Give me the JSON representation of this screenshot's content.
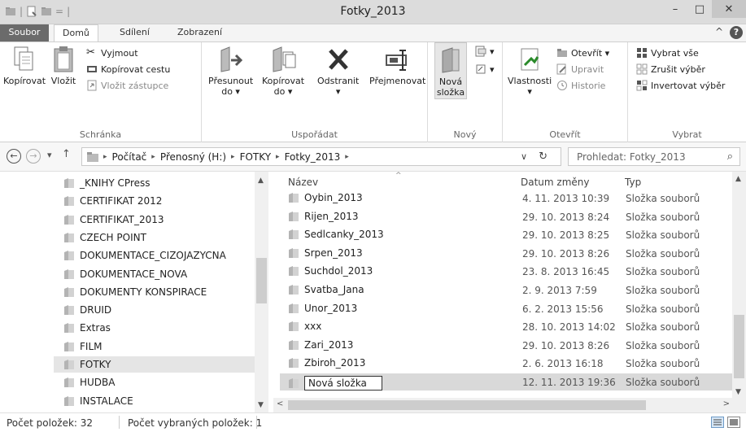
{
  "window": {
    "title": "Fotky_2013"
  },
  "window_controls": {
    "minimize": "–",
    "maximize": "□",
    "close": "✕"
  },
  "quick_access": {
    "separator": "|",
    "dropdown": "="
  },
  "ribbon_tabs": [
    "Soubor",
    "Domů",
    "Sdílení",
    "Zobrazení"
  ],
  "ribbon_ctrls": {
    "collapse": "^",
    "help": "?"
  },
  "ribbon": {
    "clipboard": {
      "label": "Schránka",
      "copy": "Kopírovat",
      "paste": "Vložit",
      "cut": "Vyjmout",
      "copy_path": "Kopírovat cestu",
      "paste_shortcut": "Vložit zástupce"
    },
    "organize": {
      "label": "Uspořádat",
      "move_to": "Přesunout",
      "move_to_2": "do ▾",
      "copy_to": "Kopírovat",
      "copy_to_2": "do ▾",
      "delete": "Odstranit",
      "delete_2": "▾",
      "rename": "Přejmenovat"
    },
    "new": {
      "label": "Nový",
      "new_folder": "Nová",
      "new_folder_2": "složka"
    },
    "open": {
      "label": "Otevřít",
      "properties": "Vlastnosti",
      "properties_2": "▾",
      "open": "Otevřít ▾",
      "edit": "Upravit",
      "history": "Historie"
    },
    "select": {
      "label": "Vybrat",
      "select_all": "Vybrat vše",
      "select_none": "Zrušit výběr",
      "invert": "Invertovat výběr"
    }
  },
  "address": {
    "back": "←",
    "forward": "→",
    "recent": "▾",
    "up": "↑",
    "breadcrumbs": [
      "Počítač",
      "Přenosný (H:)",
      "FOTKY",
      "Fotky_2013"
    ],
    "separator": "▸",
    "history_dropdown": "∨",
    "refresh": "↻",
    "search_placeholder": "Prohledat: Fotky_2013",
    "search_icon": "⌕"
  },
  "nav_pane": {
    "items": [
      "_KNIHY CPress",
      "CERTIFIKAT 2012",
      "CERTIFIKAT_2013",
      "CZECH POINT",
      "DOKUMENTACE_CIZOJAZYCNA",
      "DOKUMENTACE_NOVA",
      "DOKUMENTY KONSPIRACE",
      "DRUID",
      "Extras",
      "FILM",
      "FOTKY",
      "HUDBA",
      "INSTALACE"
    ],
    "selected": "FOTKY",
    "scroll_up": "▲",
    "scroll_down": "▼"
  },
  "file_list": {
    "columns": {
      "name": "Název",
      "date": "Datum změny",
      "type": "Typ"
    },
    "sort_indicator": "^",
    "rows": [
      {
        "name": "Oybin_2013",
        "date": "4. 11. 2013 10:39",
        "type": "Složka souborů"
      },
      {
        "name": "Rijen_2013",
        "date": "29. 10. 2013 8:24",
        "type": "Složka souborů"
      },
      {
        "name": "Sedlcanky_2013",
        "date": "29. 10. 2013 8:25",
        "type": "Složka souborů"
      },
      {
        "name": "Srpen_2013",
        "date": "29. 10. 2013 8:26",
        "type": "Složka souborů"
      },
      {
        "name": "Suchdol_2013",
        "date": "23. 8. 2013 16:45",
        "type": "Složka souborů"
      },
      {
        "name": "Svatba_Jana",
        "date": "2. 9. 2013 7:59",
        "type": "Složka souborů"
      },
      {
        "name": "Unor_2013",
        "date": "6. 2. 2013 15:56",
        "type": "Složka souborů"
      },
      {
        "name": "xxx",
        "date": "28. 10. 2013 14:02",
        "type": "Složka souborů"
      },
      {
        "name": "Zari_2013",
        "date": "29. 10. 2013 8:26",
        "type": "Složka souborů"
      },
      {
        "name": "Zbiroh_2013",
        "date": "2. 6. 2013 16:18",
        "type": "Složka souborů"
      },
      {
        "name": "Nová složka",
        "date": "12. 11. 2013 19:36",
        "type": "Složka souborů"
      }
    ],
    "renaming": "Nová složka",
    "scroll_up": "▲",
    "scroll_down": "▼",
    "scroll_left": "<",
    "scroll_right": ">"
  },
  "status": {
    "item_count": "Počet položek: 32",
    "selected_count": "Počet vybraných položek: 1"
  },
  "colors": {
    "file_tab": "#6b6b6b",
    "selection": "#d9d9d9",
    "folder": "#c9c9c9"
  }
}
